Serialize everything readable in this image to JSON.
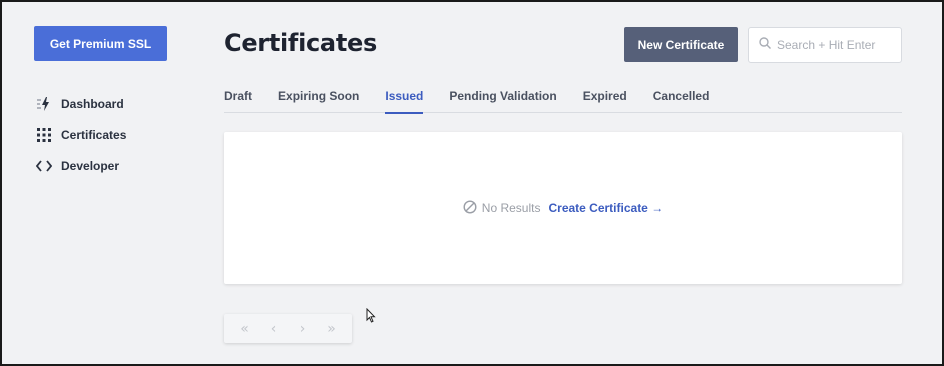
{
  "sidebar": {
    "premium_button": "Get Premium SSL",
    "items": [
      {
        "label": "Dashboard",
        "icon": "lightning-icon"
      },
      {
        "label": "Certificates",
        "icon": "grid-icon"
      },
      {
        "label": "Developer",
        "icon": "code-icon"
      }
    ]
  },
  "header": {
    "title": "Certificates",
    "new_button": "New Certificate",
    "search_placeholder": "Search + Hit Enter"
  },
  "tabs": [
    {
      "label": "Draft",
      "active": false
    },
    {
      "label": "Expiring Soon",
      "active": false
    },
    {
      "label": "Issued",
      "active": true
    },
    {
      "label": "Pending Validation",
      "active": false
    },
    {
      "label": "Expired",
      "active": false
    },
    {
      "label": "Cancelled",
      "active": false
    }
  ],
  "results": {
    "empty_text": "No Results",
    "create_link": "Create Certificate →"
  },
  "pager": {
    "first": "«",
    "prev": "‹",
    "next": "›",
    "last": "»"
  },
  "colors": {
    "accent": "#4a6ed8",
    "link": "#3c5cbf",
    "dark_button": "#566079",
    "background": "#f1f2f4"
  }
}
